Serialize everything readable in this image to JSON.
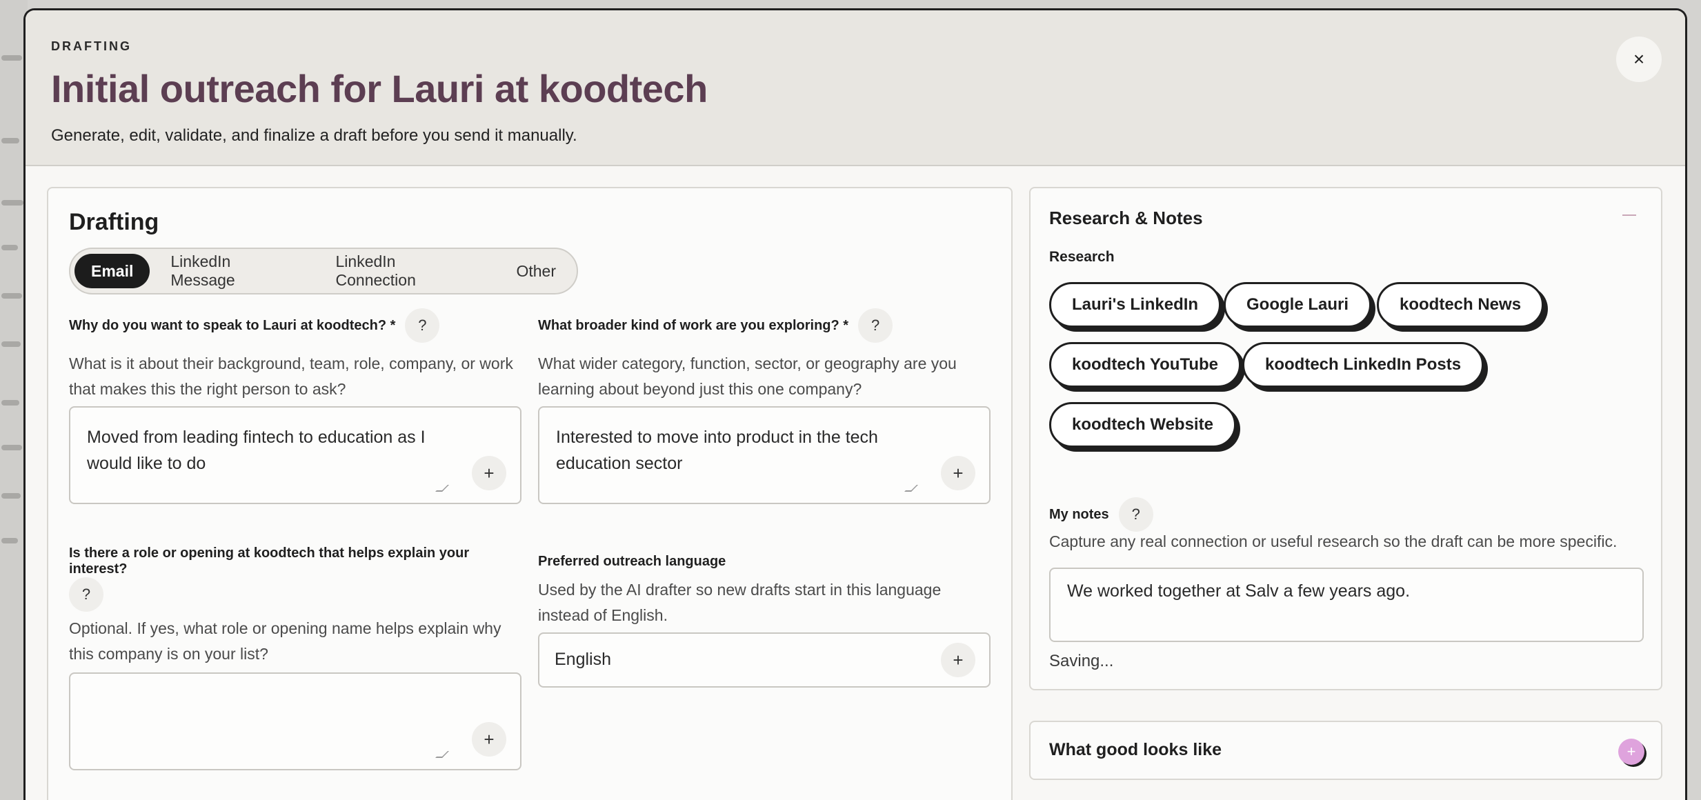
{
  "header": {
    "eyebrow": "DRAFTING",
    "title": "Initial outreach for Lauri at koodtech",
    "subtitle": "Generate, edit, validate, and finalize a draft before you send it manually.",
    "close_label": "×"
  },
  "drafting": {
    "title": "Drafting",
    "tabs": [
      {
        "label": "Email",
        "active": true
      },
      {
        "label": "LinkedIn Message",
        "active": false
      },
      {
        "label": "LinkedIn Connection",
        "active": false
      },
      {
        "label": "Other",
        "active": false
      }
    ],
    "help_icon": "?",
    "plus_icon": "+",
    "q1": {
      "label": "Why do you want to speak to Lauri at koodtech? *",
      "hint": "What is it about their background, team, role, company, or work that makes this the right person to ask?",
      "value": "Moved from leading fintech to education as I would like to do"
    },
    "q2": {
      "label": "What broader kind of work are you exploring? *",
      "hint": "What wider category, function, sector, or geography are you learning about beyond just this one company?",
      "value": "Interested to move into product in the tech education sector"
    },
    "q3": {
      "label": "Is there a role or opening at koodtech that helps explain your interest?",
      "hint": "Optional. If yes, what role or opening name helps explain why this company is on your list?",
      "value": ""
    },
    "q4": {
      "label": "Preferred outreach language",
      "hint": "Used by the AI drafter so new drafts start in this language instead of English.",
      "value": "English"
    }
  },
  "research": {
    "title": "Research & Notes",
    "research_label": "Research",
    "chips": [
      "Lauri's LinkedIn",
      "Google Lauri",
      "koodtech News",
      "koodtech YouTube",
      "koodtech LinkedIn Posts",
      "koodtech Website"
    ],
    "notes_label": "My notes",
    "notes_hint": "Capture any real connection or useful research so the draft can be more specific.",
    "notes_value": "We worked together at Salv a few years ago.",
    "saving": "Saving..."
  },
  "good": {
    "title": "What good looks like",
    "toggle": "+"
  }
}
